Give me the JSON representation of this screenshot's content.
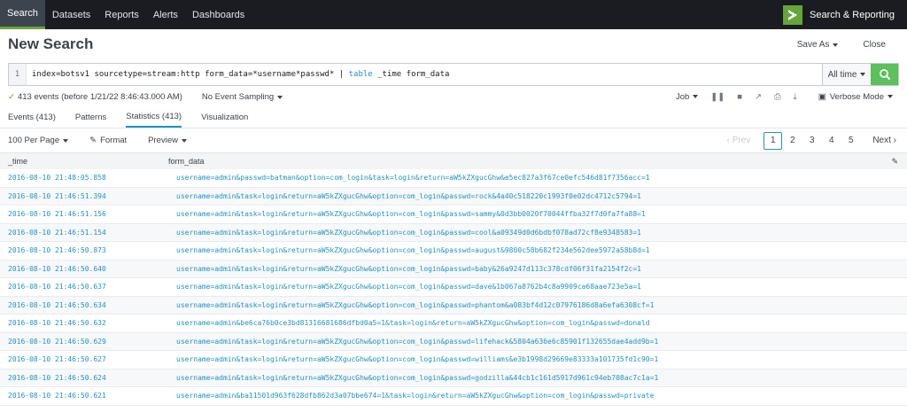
{
  "nav": {
    "items": [
      "Search",
      "Datasets",
      "Reports",
      "Alerts",
      "Dashboards"
    ],
    "app_name": "Search & Reporting"
  },
  "header": {
    "title": "New Search",
    "save_as": "Save As",
    "close": "Close"
  },
  "search": {
    "line_number": "1",
    "query_part1": "index=botsv1 sourcetype=stream:http form_data=*username*passwd* | ",
    "query_cmd": "table",
    "query_part2": " _time form_data",
    "time_range": "All time"
  },
  "status": {
    "events_text": "413 events (before 1/21/22 8:46:43.000 AM)",
    "sampling": "No Event Sampling",
    "job": "Job",
    "mode": "Verbose Mode"
  },
  "tabs": [
    "Events (413)",
    "Patterns",
    "Statistics (413)",
    "Visualization"
  ],
  "toolbar": {
    "per_page": "100 Per Page",
    "format": "Format",
    "preview": "Preview"
  },
  "pager": {
    "prev": "‹ Prev",
    "pages": [
      "1",
      "2",
      "3",
      "4",
      "5"
    ],
    "next": "Next ›"
  },
  "table": {
    "headers": [
      "_time",
      "form_data"
    ],
    "rows": [
      [
        "2016-08-10 21:48:05.858",
        "username=admin&passwd=batman&option=com_login&task=login&return=aW5kZXgucGhw&e5ec827a3f67ce0efc546d81f7356acc=1"
      ],
      [
        "2016-08-10 21:46:51.394",
        "username=admin&task=login&return=aW5kZXgucGhw&option=com_login&passwd=rock&4a40c518220c1993f0e02dc4712c5794=1"
      ],
      [
        "2016-08-10 21:46:51.156",
        "username=admin&task=login&return=aW5kZXgucGhw&option=com_login&passwd=sammy&0d3bb0020f70044ffba32f7d0fa7fa88=1"
      ],
      [
        "2016-08-10 21:46:51.154",
        "username=admin&task=login&return=aW5kZXgucGhw&option=com_login&passwd=cool&a09349d0d6bdbf078ad72cf8e9348583=1"
      ],
      [
        "2016-08-10 21:46:50.873",
        "username=admin&task=login&return=aW5kZXgucGhw&option=com_login&passwd=august&9800c58b682f234e562dee5972a58b8d=1"
      ],
      [
        "2016-08-10 21:46:50.640",
        "username=admin&task=login&return=aW5kZXgucGhw&option=com_login&passwd=baby&26a9247d113c378cdf06f31fa2154f2c=1"
      ],
      [
        "2016-08-10 21:46:50.637",
        "username=admin&task=login&return=aW5kZXgucGhw&option=com_login&passwd=dave&1b067a8762b4c8a9909ca68aae723e5a=1"
      ],
      [
        "2016-08-10 21:46:50.634",
        "username=admin&task=login&return=aW5kZXgucGhw&option=com_login&passwd=phantom&a083bf4d12c07976186d8a6efa6308cf=1"
      ],
      [
        "2016-08-10 21:46:50.632",
        "username=admin&be6ca76b0ce3bd81316681686dfbd0a5=1&task=login&return=aW5kZXgucGhw&option=com_login&passwd=donald"
      ],
      [
        "2016-08-10 21:46:50.629",
        "username=admin&task=login&return=aW5kZXgucGhw&option=com_login&passwd=lifehack&5804a636e6c85901f132655dae4add9b=1"
      ],
      [
        "2016-08-10 21:46:50.627",
        "username=admin&task=login&return=aW5kZXgucGhw&option=com_login&passwd=williams&e3b1998d29669e83333a101735fd1c90=1"
      ],
      [
        "2016-08-10 21:46:50.624",
        "username=admin&task=login&return=aW5kZXgucGhw&option=com_login&passwd=godzilla&44cb1c161d5917d961c94eb708ac7c1a=1"
      ],
      [
        "2016-08-10 21:46:50.621",
        "username=admin&ba11501d963f628dfb862d3a07bbe674=1&task=login&return=aW5kZXgucGhw&option=com_login&passwd=private"
      ]
    ]
  }
}
